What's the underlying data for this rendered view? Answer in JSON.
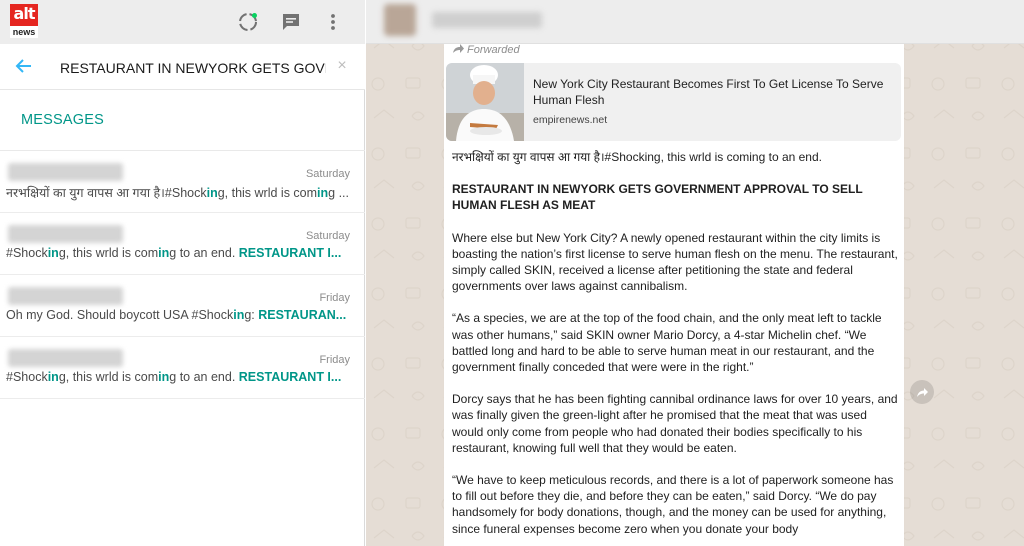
{
  "left_header": {
    "logo_top": "alt",
    "logo_bottom": "news"
  },
  "search": {
    "value": "RESTAURANT IN NEWYORK GETS GOVERNMENT APPROVAL TO SELL HUMAN FLESH AS MEAT",
    "clear_label": "×"
  },
  "results_section": {
    "label": "MESSAGES"
  },
  "results": [
    {
      "day": "Saturday",
      "pre": "नरभक्षियों का युग वापस आ गया है।#Shock",
      "m1": "in",
      "mid": "g, this wrld is com",
      "m2": "in",
      "post": "g ..."
    },
    {
      "day": "Saturday",
      "pre": "#Shock",
      "m1": "in",
      "mid": "g, this wrld is com",
      "m2": "in",
      "post": "g to an end.  ",
      "bold": "RESTAURANT I..."
    },
    {
      "day": "Friday",
      "pre": "Oh my God. Should boycott USA #Shock",
      "m1": "in",
      "mid": "g: ",
      "m2": "",
      "post": "",
      "bold": "RESTAURAN..."
    },
    {
      "day": "Friday",
      "pre": "#Shock",
      "m1": "in",
      "mid": "g, this wrld is com",
      "m2": "in",
      "post": "g to an end.  ",
      "bold": "RESTAURANT I..."
    }
  ],
  "message": {
    "forwarded_label": "Forwarded",
    "link_preview": {
      "title": "New York City Restaurant Becomes First To Get License To Serve Human Flesh",
      "domain": "empirenews.net"
    },
    "first_line": "नरभक्षियों का युग वापस आ गया है।#Shocking, this wrld is coming to an end.",
    "headline": "RESTAURANT IN NEWYORK GETS GOVERNMENT APPROVAL TO SELL HUMAN FLESH AS MEAT",
    "paragraphs": [
      "Where else but New York City? A newly opened restaurant within the city limits is boasting the nation’s first license to serve human flesh on the menu. The restaurant, simply called SKIN, received a license after petitioning the state and federal governments over laws against cannibalism.",
      "“As a species, we are at the top of the food chain, and the only meat left to tackle was other humans,” said SKIN owner Mario Dorcy, a 4-star Michelin chef. “We battled long and hard to be able to serve human meat in our restaurant, and the government finally conceded that were were in the right.”",
      "Dorcy says that he has been fighting cannibal ordinance laws for over 10 years, and was finally given the green-light after he promised that the meat that was used would only come from people who had donated their bodies specifically to his restaurant, knowing full well that they would be eaten.",
      "“We have to keep meticulous records, and there is a lot of paperwork someone has to fill out before they die, and before they can be eaten,” said Dorcy. “We do pay handsomely for body donations, though, and the money can be used for anything, since funeral expenses become zero when you donate your body"
    ]
  },
  "colors": {
    "accent_teal": "#009688",
    "back_arrow": "#33b7f6",
    "chat_bg": "#e5ddd5",
    "header_bg": "#ededed",
    "logo_red": "#e52620"
  }
}
